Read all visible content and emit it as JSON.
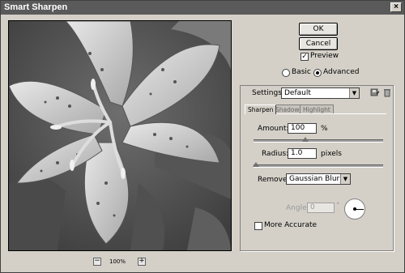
{
  "window": {
    "title": "Smart Sharpen"
  },
  "preview": {
    "zoom": "100%",
    "zoom_out": "−",
    "zoom_in": "+"
  },
  "buttons": {
    "ok": "OK",
    "cancel": "Cancel"
  },
  "options": {
    "preview_label": "Preview",
    "preview_checked": true,
    "mode_basic": "Basic",
    "mode_advanced": "Advanced",
    "mode_selected": "Advanced"
  },
  "settings": {
    "label": "Settings:",
    "value": "Default"
  },
  "tabs": [
    {
      "label": "Sharpen",
      "active": true
    },
    {
      "label": "Shadow",
      "active": false
    },
    {
      "label": "Highlight",
      "active": false
    }
  ],
  "sharpen": {
    "amount_label": "Amount:",
    "amount_value": "100",
    "amount_unit": "%",
    "amount_slider_fraction": 0.4,
    "radius_label": "Radius:",
    "radius_value": "1.0",
    "radius_unit": "pixels",
    "radius_slider_fraction": 0.02,
    "remove_label": "Remove:",
    "remove_value": "Gaussian Blur",
    "angle_label": "Angle:",
    "angle_value": "0",
    "angle_unit": "°",
    "more_accurate_label": "More Accurate",
    "more_accurate_checked": false
  },
  "icons": {
    "save": "save-settings-icon",
    "delete": "delete-settings-icon",
    "close": "close-icon"
  }
}
